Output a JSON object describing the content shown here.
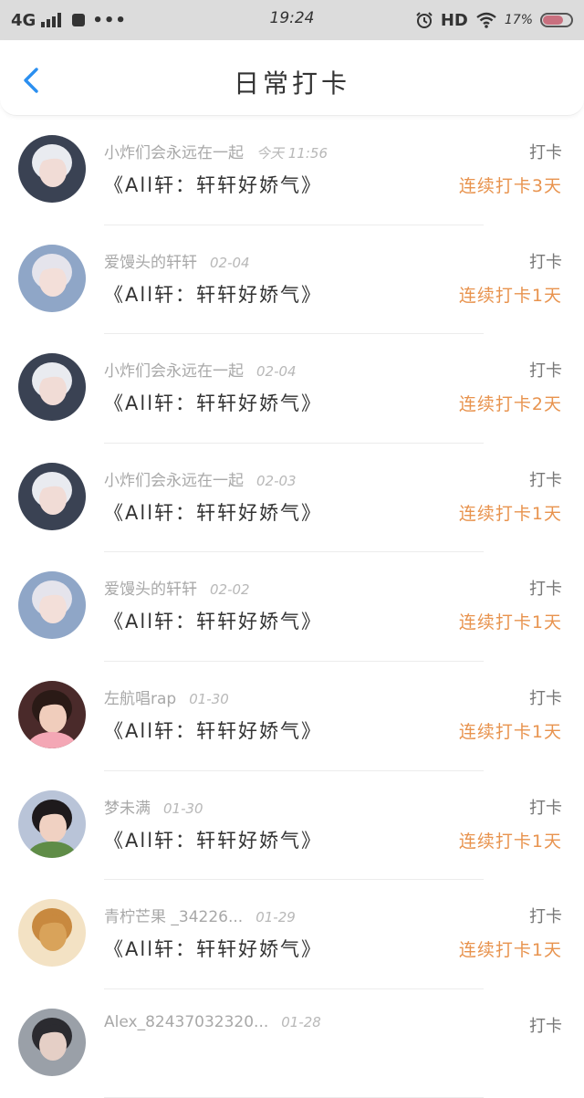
{
  "status_bar": {
    "network": "4G",
    "dots": "•••",
    "time": "19:24",
    "hd": "HD",
    "battery_text": "17%",
    "battery_level": 0.17,
    "battery_color": "#c9707f"
  },
  "header": {
    "title": "日常打卡",
    "back_icon": "chevron-left-icon",
    "accent": "#2b8ff0"
  },
  "accent_orange": "#e8934e",
  "items": [
    {
      "user": "小炸们会永远在一起",
      "date": "今天 11:56",
      "book": "《All轩：轩轩好娇气》",
      "action": "打卡",
      "streak": "连续打卡3天",
      "avatar": {
        "bg": "#3a4253",
        "hair": "#e9ebf0",
        "face": "#f1dcd6"
      }
    },
    {
      "user": "爱馒头的轩轩",
      "date": "02-04",
      "book": "《All轩：轩轩好娇气》",
      "action": "打卡",
      "streak": "连续打卡1天",
      "avatar": {
        "bg": "#8fa6c7",
        "hair": "#e5e4ec",
        "face": "#f3dfd9"
      }
    },
    {
      "user": "小炸们会永远在一起",
      "date": "02-04",
      "book": "《All轩：轩轩好娇气》",
      "action": "打卡",
      "streak": "连续打卡2天",
      "avatar": {
        "bg": "#3a4253",
        "hair": "#e9ebf0",
        "face": "#f1dcd6"
      }
    },
    {
      "user": "小炸们会永远在一起",
      "date": "02-03",
      "book": "《All轩：轩轩好娇气》",
      "action": "打卡",
      "streak": "连续打卡1天",
      "avatar": {
        "bg": "#3a4253",
        "hair": "#e9ebf0",
        "face": "#f1dcd6"
      }
    },
    {
      "user": "爱馒头的轩轩",
      "date": "02-02",
      "book": "《All轩：轩轩好娇气》",
      "action": "打卡",
      "streak": "连续打卡1天",
      "avatar": {
        "bg": "#8fa6c7",
        "hair": "#e5e4ec",
        "face": "#f3dfd9"
      }
    },
    {
      "user": "左航唱rap",
      "date": "01-30",
      "book": "《All轩：轩轩好娇气》",
      "action": "打卡",
      "streak": "连续打卡1天",
      "avatar": {
        "bg": "#4a2a2a",
        "hair": "#2a1a16",
        "face": "#f0cdbc",
        "shirt": "#f4a7b5"
      }
    },
    {
      "user": "梦未满",
      "date": "01-30",
      "book": "《All轩：轩轩好娇气》",
      "action": "打卡",
      "streak": "连续打卡1天",
      "avatar": {
        "bg": "#b9c4d8",
        "hair": "#1e1a1c",
        "face": "#f0d1c2",
        "shirt": "#5f8c47"
      }
    },
    {
      "user": "青柠芒果 _34226...",
      "date": "01-29",
      "book": "《All轩：轩轩好娇气》",
      "action": "打卡",
      "streak": "连续打卡1天",
      "avatar": {
        "bg": "#f3e2c4",
        "hair": "#c8893f",
        "face": "#d9a35a"
      }
    },
    {
      "user": "Alex_82437032320...",
      "date": "01-28",
      "book": "",
      "action": "打卡",
      "streak": "",
      "avatar": {
        "bg": "#9aa0a8",
        "hair": "#2b2b30",
        "face": "#e5cfc6"
      }
    }
  ]
}
